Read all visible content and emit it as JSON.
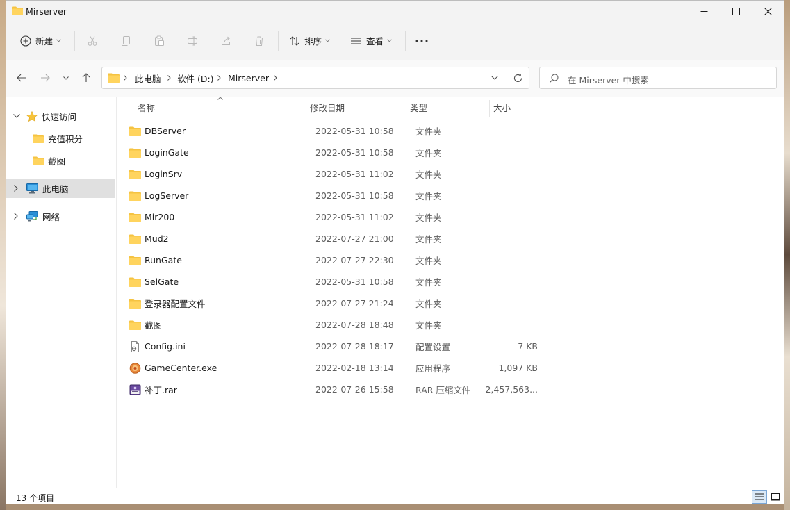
{
  "window": {
    "title": "Mirserver"
  },
  "title_buttons": {
    "minimize": "minimize",
    "maximize": "maximize",
    "close": "close"
  },
  "toolbar": {
    "new_label": "新建",
    "sort_label": "排序",
    "view_label": "查看",
    "more_label": "···"
  },
  "address": {
    "crumbs": [
      "此电脑",
      "软件 (D:)",
      "Mirserver"
    ]
  },
  "search": {
    "placeholder": "在 Mirserver 中搜索"
  },
  "sidebar": {
    "quick_access": "快速访问",
    "quick_items": [
      "充值积分",
      "截图"
    ],
    "this_pc": "此电脑",
    "network": "网络"
  },
  "columns": {
    "name": "名称",
    "date": "修改日期",
    "type": "类型",
    "size": "大小"
  },
  "files": [
    {
      "name": "DBServer",
      "date": "2022-05-31 10:58",
      "type": "文件夹",
      "size": "",
      "icon": "folder-icon"
    },
    {
      "name": "LoginGate",
      "date": "2022-05-31 10:58",
      "type": "文件夹",
      "size": "",
      "icon": "folder-icon"
    },
    {
      "name": "LoginSrv",
      "date": "2022-05-31 11:02",
      "type": "文件夹",
      "size": "",
      "icon": "folder-icon"
    },
    {
      "name": "LogServer",
      "date": "2022-05-31 10:58",
      "type": "文件夹",
      "size": "",
      "icon": "folder-icon"
    },
    {
      "name": "Mir200",
      "date": "2022-05-31 11:02",
      "type": "文件夹",
      "size": "",
      "icon": "folder-icon"
    },
    {
      "name": "Mud2",
      "date": "2022-07-27 21:00",
      "type": "文件夹",
      "size": "",
      "icon": "folder-icon"
    },
    {
      "name": "RunGate",
      "date": "2022-07-27 22:30",
      "type": "文件夹",
      "size": "",
      "icon": "folder-icon"
    },
    {
      "name": "SelGate",
      "date": "2022-05-31 10:58",
      "type": "文件夹",
      "size": "",
      "icon": "folder-icon"
    },
    {
      "name": "登录器配置文件",
      "date": "2022-07-27 21:24",
      "type": "文件夹",
      "size": "",
      "icon": "folder-icon"
    },
    {
      "name": "截图",
      "date": "2022-07-28 18:48",
      "type": "文件夹",
      "size": "",
      "icon": "folder-icon"
    },
    {
      "name": "Config.ini",
      "date": "2022-07-28 18:17",
      "type": "配置设置",
      "size": "7 KB",
      "icon": "ini-file-icon"
    },
    {
      "name": "GameCenter.exe",
      "date": "2022-02-18 13:14",
      "type": "应用程序",
      "size": "1,097 KB",
      "icon": "exe-file-icon"
    },
    {
      "name": "补丁.rar",
      "date": "2022-07-26 15:58",
      "type": "RAR 压缩文件",
      "size": "2,457,563...",
      "icon": "rar-file-icon"
    }
  ],
  "status": {
    "count_text": "13 个项目"
  },
  "colors": {
    "folder": "#f5c342",
    "selected_nav": "#e0e0e0",
    "accent": "#0067c0"
  }
}
